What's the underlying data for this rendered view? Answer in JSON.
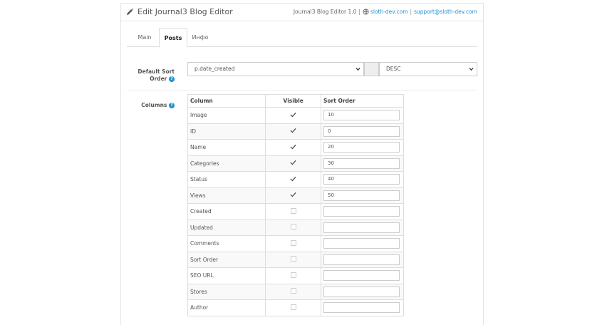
{
  "header": {
    "title": "Edit Journal3 Blog Editor",
    "version": "Journal3 Blog Editor 1.0",
    "site_link": "sloth-dev.com",
    "support_link": "support@sloth-dev.com",
    "separator": "|"
  },
  "tabs": [
    {
      "label": "Main"
    },
    {
      "label": "Posts"
    },
    {
      "label": "Инфо"
    }
  ],
  "sort": {
    "label_line1": "Default Sort",
    "label_line2": "Order",
    "field_value": "p.date_created",
    "direction_value": "DESC"
  },
  "columns": {
    "label": "Columns",
    "headers": [
      "Column",
      "Visible",
      "Sort Order"
    ],
    "rows": [
      {
        "name": "Image",
        "visible": true,
        "order": "10"
      },
      {
        "name": "ID",
        "visible": true,
        "order": "0"
      },
      {
        "name": "Name",
        "visible": true,
        "order": "20"
      },
      {
        "name": "Categories",
        "visible": true,
        "order": "30"
      },
      {
        "name": "Status",
        "visible": true,
        "order": "40"
      },
      {
        "name": "Views",
        "visible": true,
        "order": "50"
      },
      {
        "name": "Created",
        "visible": false,
        "order": ""
      },
      {
        "name": "Updated",
        "visible": false,
        "order": ""
      },
      {
        "name": "Comments",
        "visible": false,
        "order": ""
      },
      {
        "name": "Sort Order",
        "visible": false,
        "order": ""
      },
      {
        "name": "SEO URL",
        "visible": false,
        "order": ""
      },
      {
        "name": "Stores",
        "visible": false,
        "order": ""
      },
      {
        "name": "Author",
        "visible": false,
        "order": ""
      }
    ]
  },
  "colors": {
    "link": "#1e91cf",
    "border": "#dddddd"
  },
  "icons": {
    "title": "pencil-icon",
    "site": "globe-icon",
    "help": "question-circle-icon",
    "visible": "check-icon",
    "select": "chevron-down-icon"
  }
}
